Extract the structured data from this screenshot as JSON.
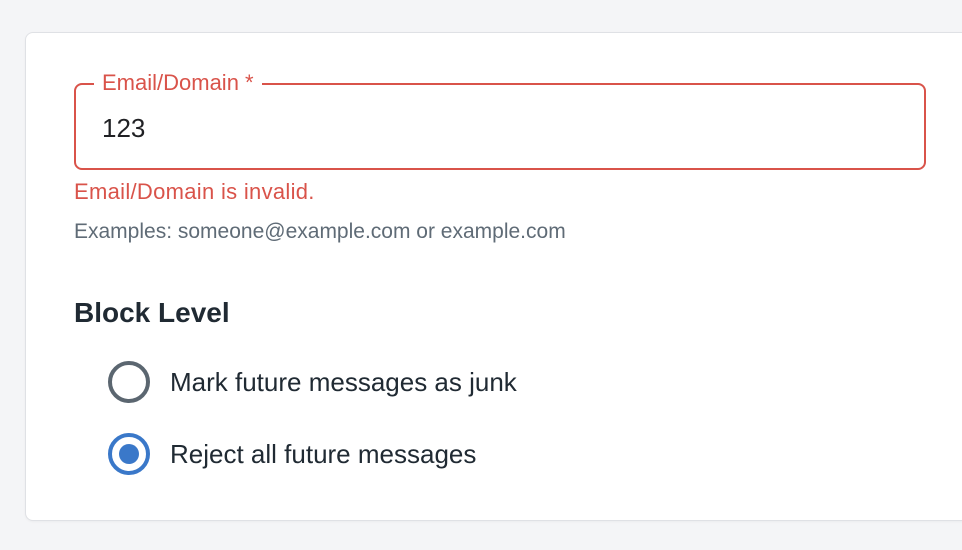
{
  "form": {
    "email_field": {
      "label": "Email/Domain *",
      "value": "123",
      "error": "Email/Domain is invalid.",
      "helper": "Examples: someone@example.com or example.com"
    },
    "block_level": {
      "title": "Block Level",
      "options": [
        {
          "label": "Mark future messages as junk",
          "selected": false
        },
        {
          "label": "Reject all future messages",
          "selected": true
        }
      ]
    }
  },
  "colors": {
    "error": "#d9534a",
    "accent": "#3a78c9",
    "text": "#202a33",
    "helper": "#5f6b76"
  }
}
